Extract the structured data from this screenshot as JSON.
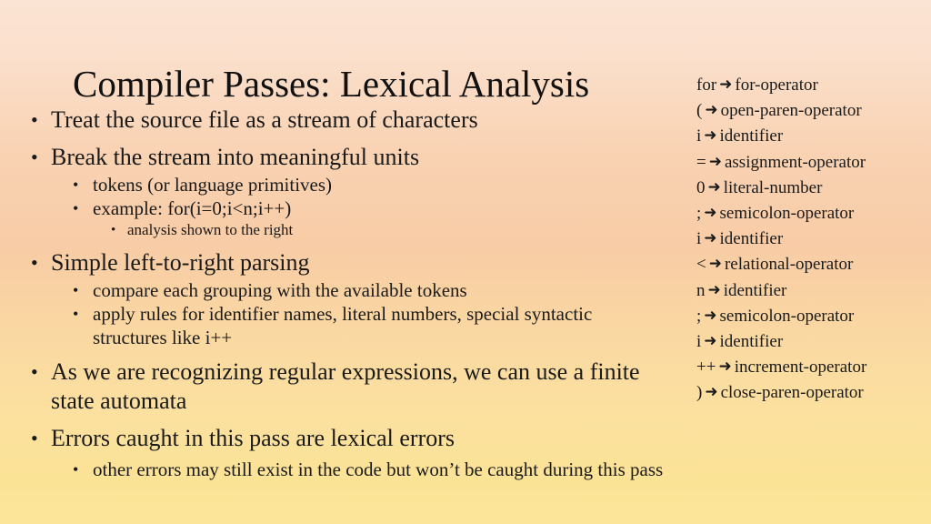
{
  "slide": {
    "title": "Compiler Passes:  Lexical Analysis",
    "background": {
      "top_color": "#fbe4d4",
      "mid_color": "#f8cca6",
      "bottom_color": "#fce499"
    },
    "text_color": "#1a1a1a"
  },
  "outline": [
    {
      "level": 1,
      "text": "Treat the source file as a stream of characters"
    },
    {
      "level": 1,
      "text": "Break the stream into meaningful units"
    },
    {
      "level": 2,
      "text": "tokens (or language primitives)"
    },
    {
      "level": 2,
      "text": "example:  for(i=0;i<n;i++)"
    },
    {
      "level": 3,
      "text": "analysis shown to the right"
    },
    {
      "level": 1,
      "text": "Simple left-to-right parsing"
    },
    {
      "level": 2,
      "text": "compare each grouping with the available tokens"
    },
    {
      "level": 2,
      "text": "apply rules for identifier names, literal numbers, special syntactic structures like i++"
    },
    {
      "level": 1,
      "text": "As we are recognizing regular expressions, we can use a finite state automata"
    },
    {
      "level": 1,
      "text": "Errors caught in this pass are lexical errors"
    },
    {
      "level": 2,
      "text": "other errors may still exist in the code but won’t be caught during this pass"
    }
  ],
  "bullet_glyph": "•",
  "tokens": {
    "arrow_glyph": "➜",
    "items": [
      {
        "lexeme": "for",
        "token": "for-operator"
      },
      {
        "lexeme": "(",
        "token": "open-paren-operator"
      },
      {
        "lexeme": "i",
        "token": "identifier"
      },
      {
        "lexeme": "=",
        "token": "assignment-operator"
      },
      {
        "lexeme": "0",
        "token": "literal-number"
      },
      {
        "lexeme": ";",
        "token": "semicolon-operator"
      },
      {
        "lexeme": "i",
        "token": "identifier"
      },
      {
        "lexeme": "<",
        "token": "relational-operator"
      },
      {
        "lexeme": "n",
        "token": "identifier"
      },
      {
        "lexeme": ";",
        "token": "semicolon-operator"
      },
      {
        "lexeme": "i",
        "token": "identifier"
      },
      {
        "lexeme": "++",
        "token": "increment-operator"
      },
      {
        "lexeme": ")",
        "token": "close-paren-operator"
      }
    ]
  }
}
